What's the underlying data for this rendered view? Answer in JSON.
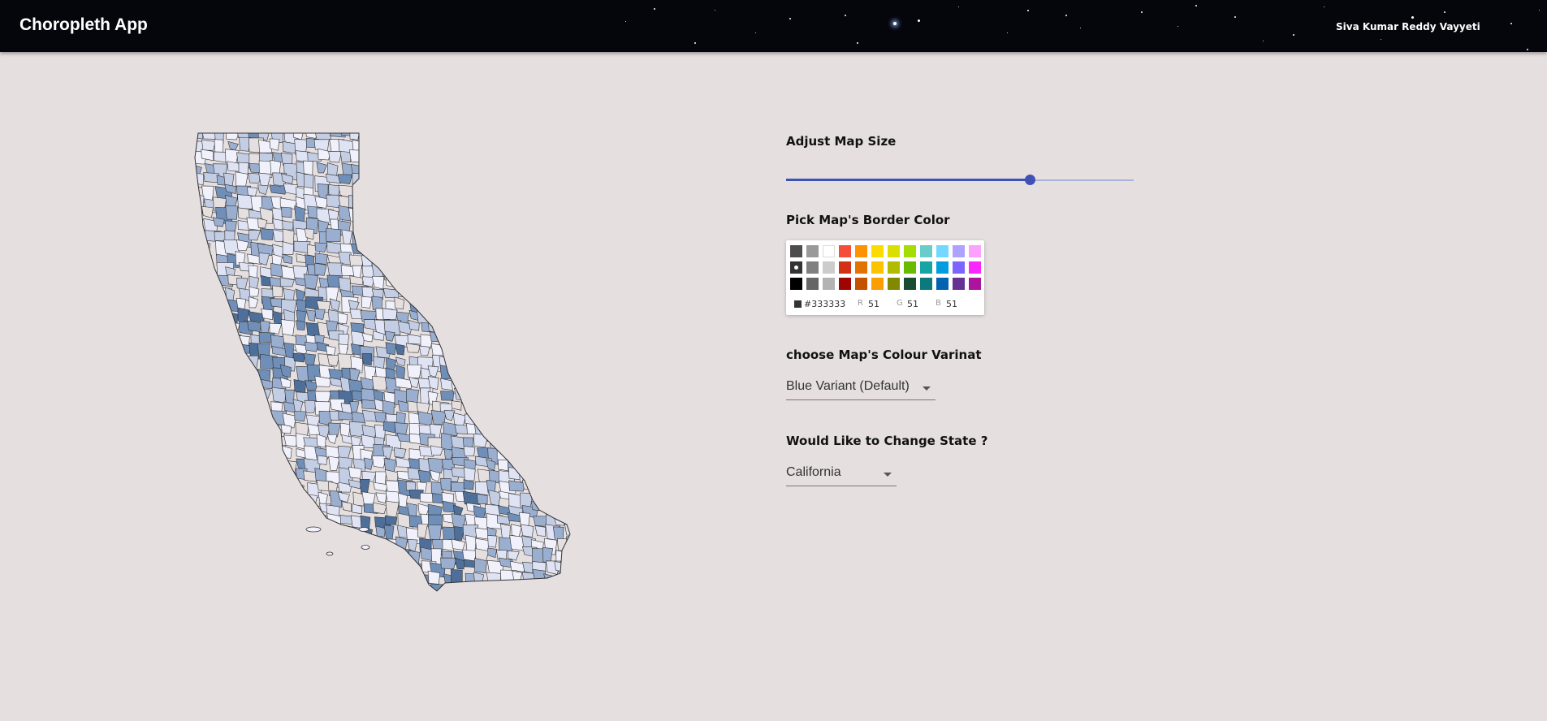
{
  "app": {
    "title": "Choropleth App",
    "user_name": "Siva Kumar Reddy Vayyeti"
  },
  "controls": {
    "map_size": {
      "label": "Adjust Map Size",
      "value_fraction": 0.7
    },
    "border_color": {
      "label": "Pick Map's Border Color",
      "selected_hex": "#333333",
      "r_label": "R",
      "r_value": "51",
      "g_label": "G",
      "g_value": "51",
      "b_label": "B",
      "b_value": "51",
      "palette": [
        [
          "#4D4D4D",
          "#999999",
          "#FFFFFF",
          "#F44E3B",
          "#FE9200",
          "#FCDC00",
          "#DBDF00",
          "#A4DD00",
          "#68CCCA",
          "#73D8FF",
          "#AEA1FF",
          "#FDA1FF"
        ],
        [
          "#333333",
          "#808080",
          "#CCCCCC",
          "#D33115",
          "#E27300",
          "#FCC400",
          "#B0BC00",
          "#68BC00",
          "#16A5A5",
          "#009CE0",
          "#7B64FF",
          "#FA28FF"
        ],
        [
          "#000000",
          "#666666",
          "#B3B3B3",
          "#9F0500",
          "#C45100",
          "#FB9E00",
          "#808900",
          "#194D33",
          "#0C797D",
          "#0062B1",
          "#653294",
          "#AB149E"
        ]
      ]
    },
    "colour_variant": {
      "label": "choose Map's Colour Varinat",
      "selected": "Blue Variant (Default)"
    },
    "state": {
      "label": "Would Like to Change State ?",
      "selected": "California"
    }
  },
  "map": {
    "state": "California",
    "fill_colors": [
      "#f0f1fb",
      "#dfe3f3",
      "#c3cde4",
      "#9aaed0",
      "#6f8fb8",
      "#4e6f9a"
    ],
    "border_color": "#333333"
  }
}
